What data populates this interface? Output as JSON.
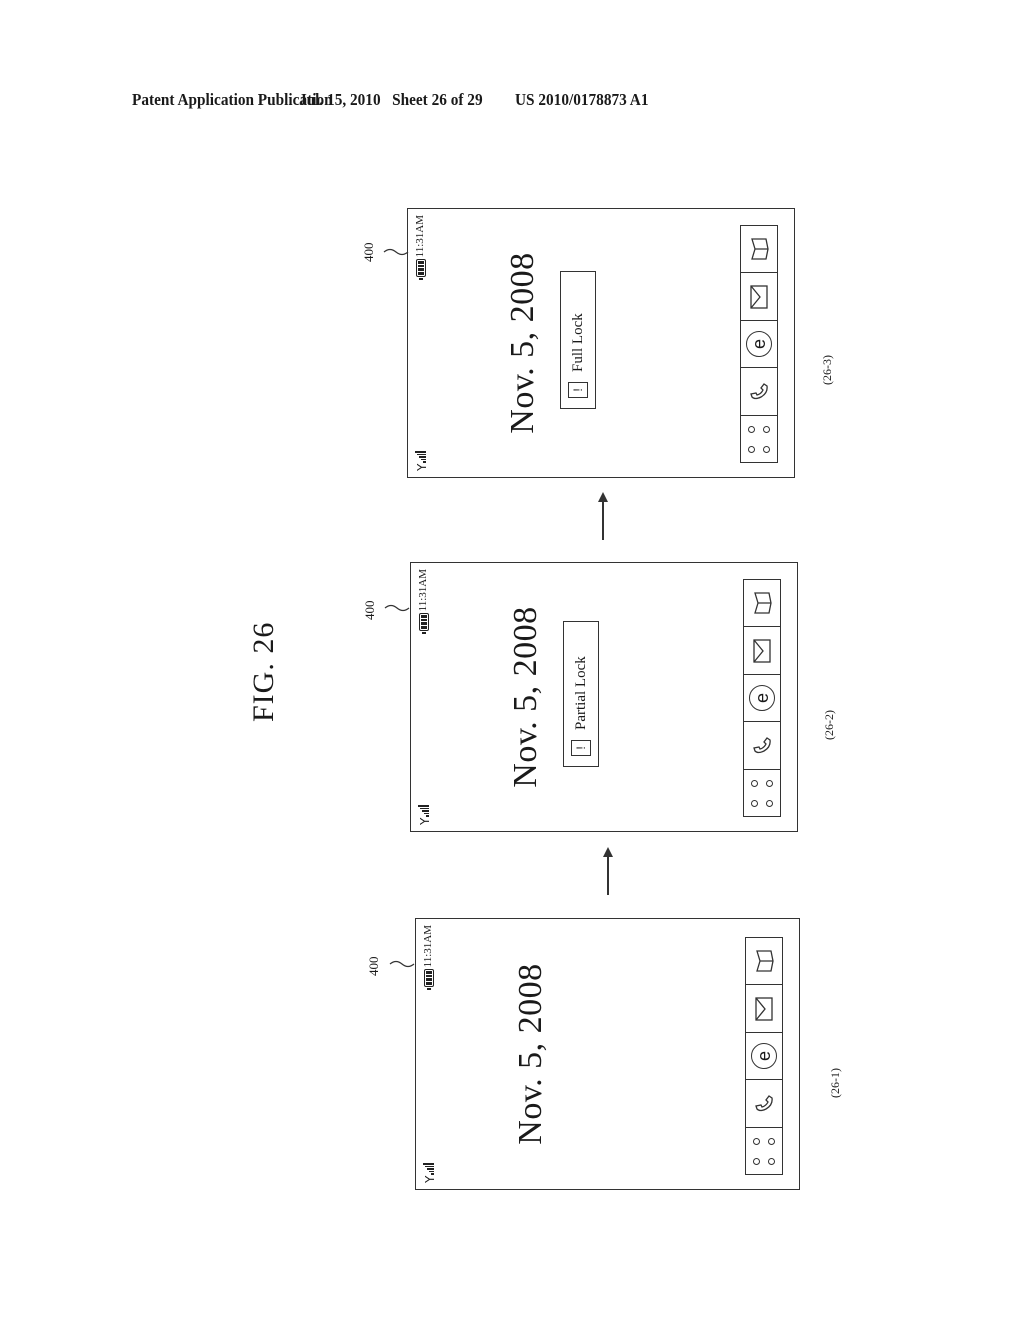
{
  "header": {
    "publication": "Patent Application Publication",
    "date_sheet": "Jul. 15, 2010   Sheet 26 of 29",
    "patent_number": "US 2010/0178873 A1"
  },
  "figure": {
    "title": "FIG. 26",
    "flow": "26-1 → 26-2 → 26-3"
  },
  "panels": [
    {
      "caption": "(26-1)",
      "ref_label": "400",
      "clock": "11:31AM",
      "date": "Nov. 5, 2008",
      "lock_message": null,
      "dock_icons": [
        "menu-grid-icon",
        "phone-icon",
        "browser-e-icon",
        "message-envelope-icon",
        "book-icon"
      ]
    },
    {
      "caption": "(26-2)",
      "ref_label": "400",
      "clock": "11:31AM",
      "date": "Nov. 5, 2008",
      "lock_message": "Partial Lock",
      "lock_symbol": "!",
      "dock_icons": [
        "menu-grid-icon",
        "phone-icon",
        "browser-e-icon",
        "message-envelope-icon",
        "book-icon"
      ]
    },
    {
      "caption": "(26-3)",
      "ref_label": "400",
      "clock": "11:31AM",
      "date": "Nov. 5, 2008",
      "lock_message": "Full Lock",
      "lock_symbol": "!",
      "dock_icons": [
        "menu-grid-icon",
        "phone-icon",
        "browser-e-icon",
        "message-envelope-icon",
        "book-icon"
      ]
    }
  ],
  "icons": {
    "e_glyph": "e",
    "phone_glyph": "✆"
  }
}
